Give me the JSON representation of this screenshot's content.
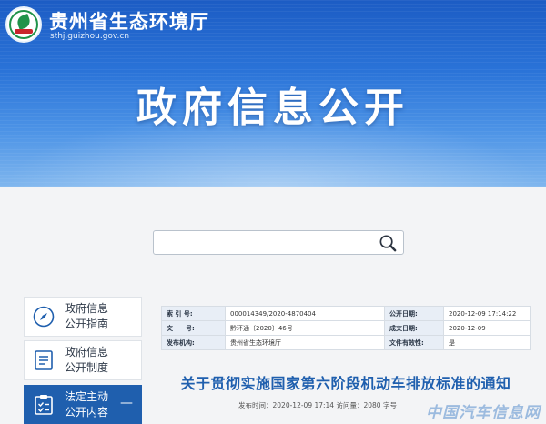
{
  "header": {
    "site_name": "贵州省生态环境厅",
    "site_url": "sthj.guizhou.gov.cn",
    "hero_title": "政府信息公开"
  },
  "search": {
    "placeholder": ""
  },
  "sidebar": {
    "items": [
      {
        "label": "政府信息\n公开指南",
        "icon": "compass-icon",
        "active": false
      },
      {
        "label": "政府信息\n公开制度",
        "icon": "list-document-icon",
        "active": false
      },
      {
        "label": "法定主动\n公开内容",
        "icon": "checklist-document-icon",
        "active": true,
        "suffix": "—"
      }
    ]
  },
  "meta": {
    "rows": [
      {
        "k1": "索 引 号:",
        "v1": "000014349/2020-4870404",
        "k2": "公开日期:",
        "v2": "2020-12-09 17:14:22"
      },
      {
        "k1": "文　　号:",
        "v1": "黔环通〔2020〕46号",
        "k2": "成文日期:",
        "v2": "2020-12-09"
      },
      {
        "k1": "发布机构:",
        "v1": "贵州省生态环境厅",
        "k2": "文件有效性:",
        "v2": "是"
      }
    ]
  },
  "document": {
    "title": "关于贯彻实施国家第六阶段机动车排放标准的通知",
    "meta_line": "发布时间：2020-12-09 17:14 访问量：2080 字号"
  },
  "watermark": "中国汽车信息网",
  "colors": {
    "banner": "#2a73d8",
    "accent": "#1f5fae",
    "logo_green": "#20934a"
  }
}
